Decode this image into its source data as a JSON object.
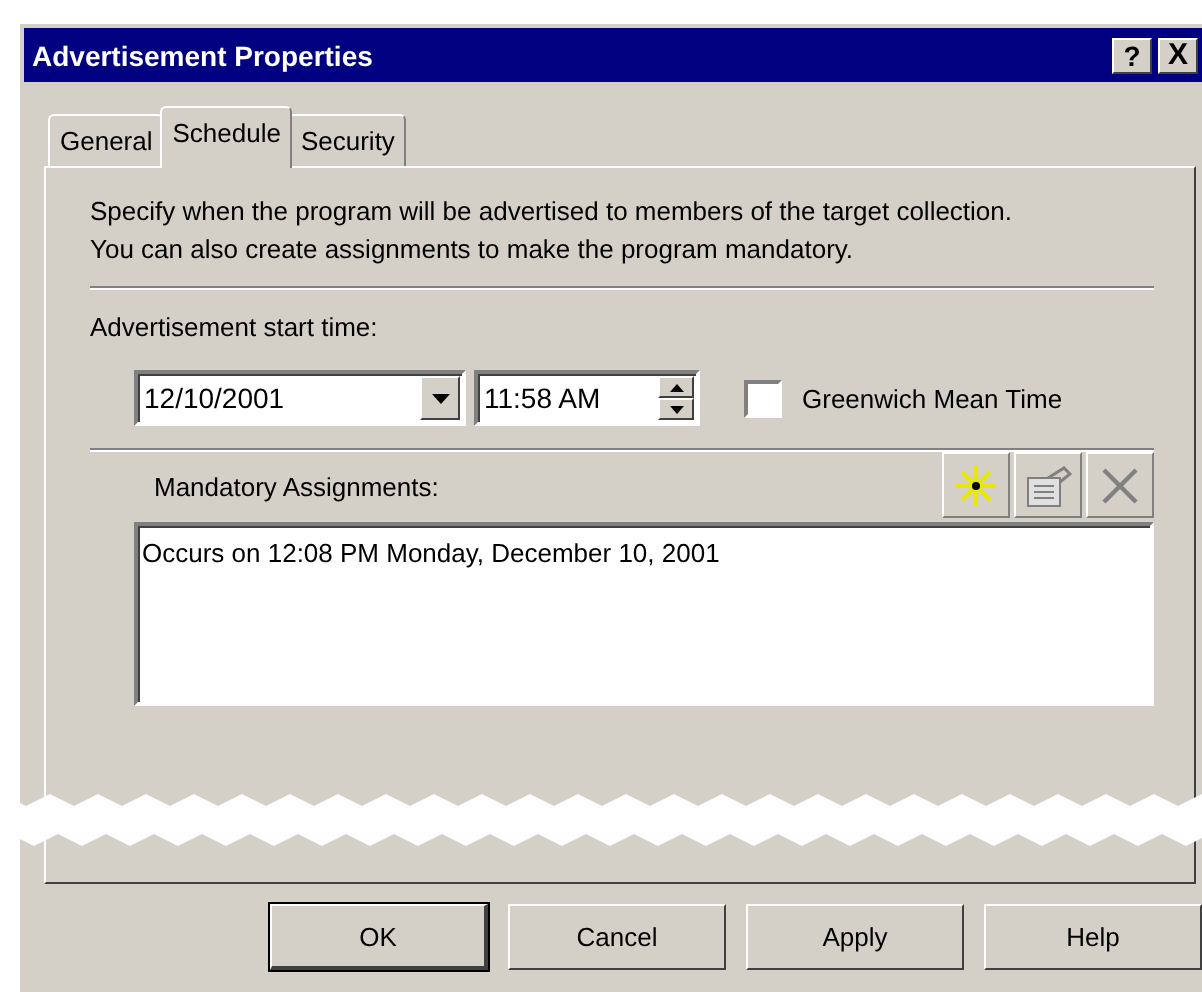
{
  "window": {
    "title": "Advertisement Properties",
    "title_buttons": [
      {
        "kind": "help",
        "label": "?"
      },
      {
        "kind": "close",
        "label": "X"
      }
    ]
  },
  "tabs": [
    {
      "label": "General",
      "selected": false
    },
    {
      "label": "Schedule",
      "selected": true
    },
    {
      "label": "Security",
      "selected": false
    }
  ],
  "description": "Specify when the program will be advertised to members of the target collection. You can also create assignments to make the program mandatory.",
  "start_time": {
    "label": "Advertisement start time:",
    "date": "12/10/2001",
    "time": "11:58 AM"
  },
  "gmt": {
    "label": "Greenwich Mean Time",
    "checked": false
  },
  "assignments": {
    "label": "Mandatory Assignments:",
    "tools": [
      {
        "kind": "new",
        "disabled": false
      },
      {
        "kind": "properties",
        "disabled": true
      },
      {
        "kind": "delete",
        "disabled": true
      }
    ],
    "items": [
      "Occurs on 12:08 PM Monday, December 10, 2001"
    ]
  },
  "buttons": [
    {
      "label": "OK",
      "default": true
    },
    {
      "label": "Cancel",
      "default": false
    },
    {
      "label": "Apply",
      "default": false
    },
    {
      "label": "Help",
      "default": false
    }
  ]
}
